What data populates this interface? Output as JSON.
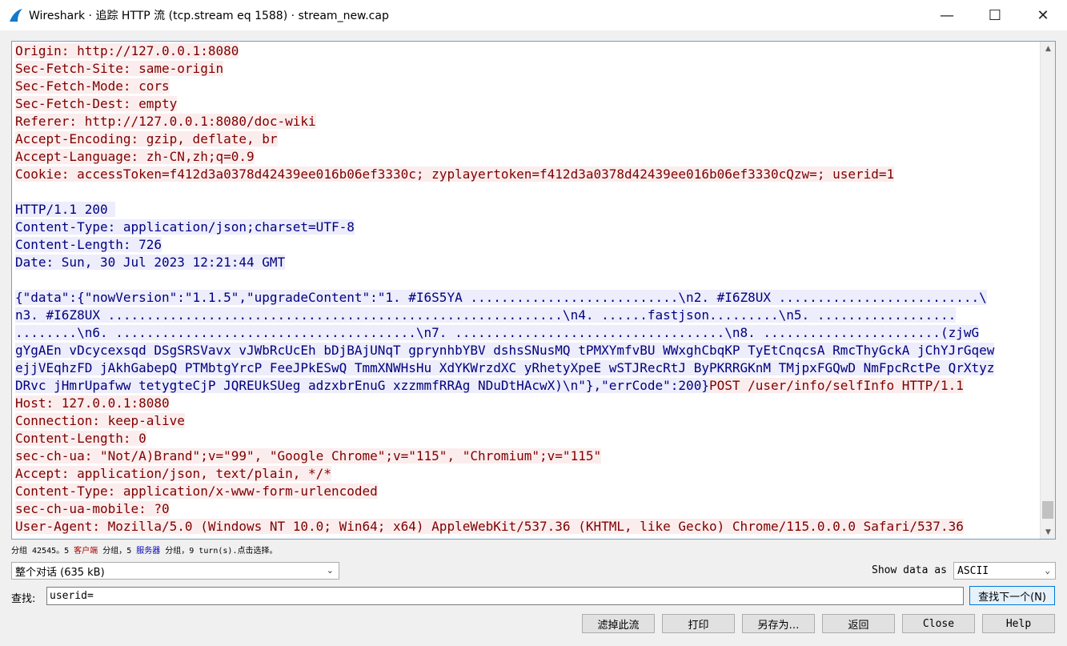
{
  "window": {
    "title": "Wireshark · 追踪 HTTP 流 (tcp.stream eq 1588) · stream_new.cap",
    "minimize": "—",
    "maximize": "☐",
    "close": "✕"
  },
  "stream": {
    "lines": [
      {
        "t": "c",
        "text": "Origin: http://127.0.0.1:8080"
      },
      {
        "t": "c",
        "text": "Sec-Fetch-Site: same-origin"
      },
      {
        "t": "c",
        "text": "Sec-Fetch-Mode: cors"
      },
      {
        "t": "c",
        "text": "Sec-Fetch-Dest: empty"
      },
      {
        "t": "c",
        "text": "Referer: http://127.0.0.1:8080/doc-wiki"
      },
      {
        "t": "c",
        "text": "Accept-Encoding: gzip, deflate, br"
      },
      {
        "t": "c",
        "text": "Accept-Language: zh-CN,zh;q=0.9"
      },
      {
        "t": "c",
        "text": "Cookie: accessToken=f412d3a0378d42439ee016b06ef3330c; zyplayertoken=f412d3a0378d42439ee016b06ef3330cQzw=; userid=1"
      },
      {
        "t": "b",
        "text": ""
      },
      {
        "t": "s",
        "text": "HTTP/1.1 200 "
      },
      {
        "t": "s",
        "text": "Content-Type: application/json;charset=UTF-8"
      },
      {
        "t": "s",
        "text": "Content-Length: 726"
      },
      {
        "t": "s",
        "text": "Date: Sun, 30 Jul 2023 12:21:44 GMT"
      },
      {
        "t": "b",
        "text": ""
      },
      {
        "t": "s",
        "text": "{\"data\":{\"nowVersion\":\"1.1.5\",\"upgradeContent\":\"1. #I6S5YA ...........................\\n2. #I6Z8UX ..........................\\"
      },
      {
        "t": "s",
        "text": "n3. #I6Z8UX ...........................................................\\n4. ......fastjson.........\\n5. .................."
      },
      {
        "t": "s",
        "text": "........\\n6. .......................................\\n7. ...................................\\n8. .......................(zjwG"
      },
      {
        "t": "s",
        "text": "gYgAEn vDcycexsqd DSgSRSVavx vJWbRcUcEh bDjBAjUNqT gprynhbYBV dshsSNusMQ tPMXYmfvBU WWxghCbqKP TyEtCnqcsA RmcThyGckA jChYJrGqew"
      },
      {
        "t": "s",
        "text": "ejjVEqhzFD jAkhGabepQ PTMbtgYrcP FeeJPkESwQ TmmXNWHsHu XdYKWrzdXC yRhetyXpeE wSTJRecRtJ ByPKRRGKnM TMjpxFGQwD NmFpcRctPe QrXtyz"
      },
      {
        "t": "m",
        "srv": "DRvc jHmrUpafww tetygteCjP JQREUkSUeg adzxbrEnuG xzzmmfRRAg NDuDtHAcwX)\\n\"},\"errCode\":200}",
        "cli": "POST /user/info/selfInfo HTTP/1.1"
      },
      {
        "t": "c",
        "text": "Host: 127.0.0.1:8080"
      },
      {
        "t": "c",
        "text": "Connection: keep-alive"
      },
      {
        "t": "c",
        "text": "Content-Length: 0"
      },
      {
        "t": "c",
        "text": "sec-ch-ua: \"Not/A)Brand\";v=\"99\", \"Google Chrome\";v=\"115\", \"Chromium\";v=\"115\""
      },
      {
        "t": "c",
        "text": "Accept: application/json, text/plain, */*"
      },
      {
        "t": "c",
        "text": "Content-Type: application/x-www-form-urlencoded"
      },
      {
        "t": "c",
        "text": "sec-ch-ua-mobile: ?0"
      },
      {
        "t": "c",
        "text": "User-Agent: Mozilla/5.0 (Windows NT 10.0; Win64; x64) AppleWebKit/537.36 (KHTML, like Gecko) Chrome/115.0.0.0 Safari/537.36"
      }
    ]
  },
  "status": {
    "prefix": "分组 42545。5 ",
    "client": "客户端",
    "mid": " 分组，5 ",
    "server": "服务器",
    "suffix": " 分组，9 turn(s).点击选择。"
  },
  "conversation_select": {
    "value": "整个对话 (635 kB)"
  },
  "show_data": {
    "label": "Show data as",
    "value": "ASCII"
  },
  "find": {
    "label": "查找:",
    "value": "userid=",
    "next_button": "查找下一个(N)"
  },
  "buttons": {
    "filter": "滤掉此流",
    "print": "打印",
    "save_as": "另存为…",
    "back": "返回",
    "close": "Close",
    "help": "Help"
  },
  "colors": {
    "client_bg": "#fbeded",
    "client_fg": "#7f0000",
    "server_bg": "#ededfb",
    "server_fg": "#00007f"
  }
}
